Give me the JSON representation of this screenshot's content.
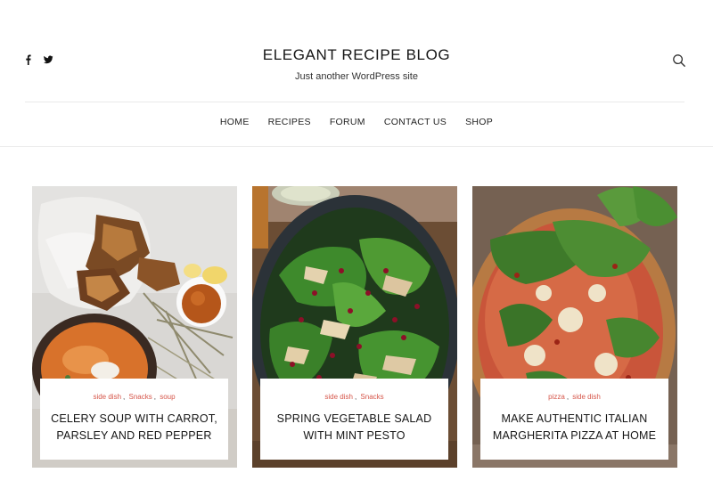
{
  "header": {
    "site_title": "ELEGANT RECIPE BLOG",
    "tagline": "Just another WordPress site",
    "social_icons": [
      "facebook-icon",
      "twitter-icon"
    ],
    "search_icon": "search-icon"
  },
  "nav": {
    "items": [
      {
        "label": "HOME"
      },
      {
        "label": "RECIPES"
      },
      {
        "label": "FORUM"
      },
      {
        "label": "CONTACT US"
      },
      {
        "label": "SHOP"
      }
    ]
  },
  "posts": [
    {
      "categories": [
        "side dish",
        "Snacks",
        "soup"
      ],
      "title": "CELERY SOUP WITH CARROT, PARSLEY AND RED PEPPER"
    },
    {
      "categories": [
        "side dish",
        "Snacks"
      ],
      "title": "SPRING VEGETABLE SALAD WITH MINT PESTO"
    },
    {
      "categories": [
        "pizza",
        "side dish"
      ],
      "title": "MAKE AUTHENTIC ITALIAN MARGHERITA PIZZA AT HOME"
    }
  ],
  "colors": {
    "category_link": "#d6564a",
    "text": "#151515",
    "divider": "#e9e9e9"
  }
}
